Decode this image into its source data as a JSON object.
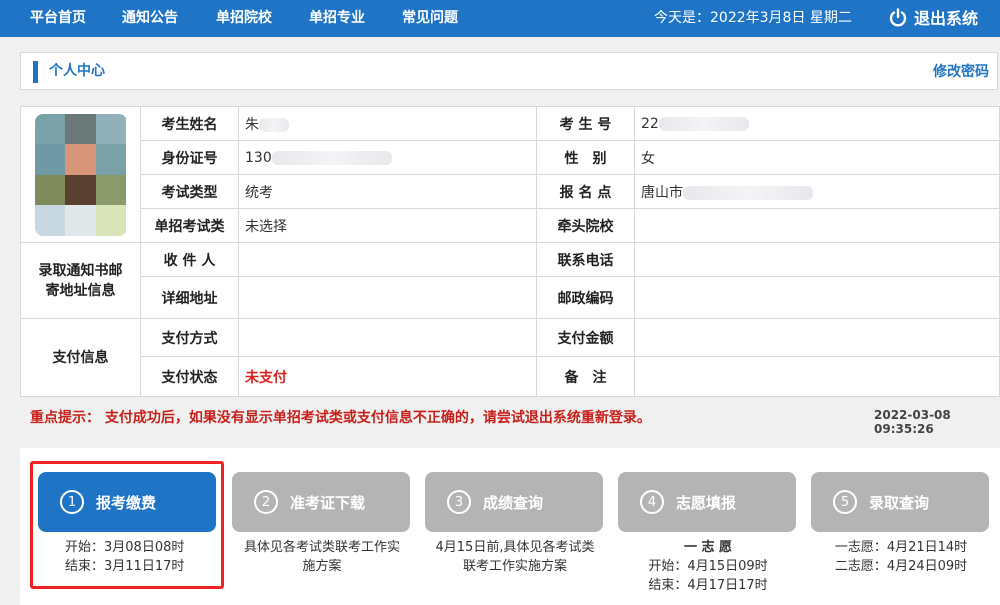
{
  "nav": {
    "items": [
      "平台首页",
      "通知公告",
      "单招院校",
      "单招专业",
      "常见问题"
    ],
    "today": "今天是：2022年3月8日 星期二",
    "logout": "退出系统"
  },
  "panel": {
    "title": "个人中心",
    "change_password": "修改密码"
  },
  "info": {
    "name_label": "考生姓名",
    "name_value": "朱",
    "examno_label": "考 生 号",
    "examno_value": "22",
    "id_label": "身份证号",
    "id_value": "130",
    "gender_label": "性　别",
    "gender_value": "女",
    "examtype_label": "考试类型",
    "examtype_value": "统考",
    "site_label": "报 名 点",
    "site_value": "唐山市",
    "category_label": "单招考试类",
    "category_value": "未选择",
    "lead_label": "牵头院校",
    "lead_value": "",
    "mail_section": "录取通知书邮寄地址信息",
    "receiver_label": "收 件 人",
    "receiver_value": "",
    "phone_label": "联系电话",
    "phone_value": "",
    "address_label": "详细地址",
    "address_value": "",
    "zip_label": "邮政编码",
    "zip_value": "",
    "pay_section": "支付信息",
    "paymethod_label": "支付方式",
    "paymethod_value": "",
    "payamount_label": "支付金额",
    "payamount_value": "",
    "paystatus_label": "支付状态",
    "paystatus_value": "未支付",
    "remark_label": "备　注",
    "remark_value": ""
  },
  "tip": "重点提示：  支付成功后，如果没有显示单招考试类或支付信息不正确的，请尝试退出系统重新登录。",
  "timestamp": "2022-03-08 09:35:26",
  "steps": [
    {
      "num": "1",
      "label": "报考缴费",
      "desc": [
        "开始：3月08日08时",
        "结束：3月11日17时"
      ]
    },
    {
      "num": "2",
      "label": "准考证下载",
      "desc": [
        "具体见各考试类联考工作实施方案"
      ]
    },
    {
      "num": "3",
      "label": "成绩查询",
      "desc": [
        "4月15日前,具体见各考试类联考工作实施方案"
      ]
    },
    {
      "num": "4",
      "label": "志愿填报",
      "desc": [
        "一 志 愿",
        "开始：4月15日09时",
        "结束：4月17日17时"
      ]
    },
    {
      "num": "5",
      "label": "录取查询",
      "desc": [
        "一志愿：4月21日14时",
        "二志愿：4月24日09时"
      ]
    }
  ],
  "colors": {
    "primary": "#1f74c6",
    "inactive_step": "#b4b4b4",
    "alert": "#e02020"
  }
}
